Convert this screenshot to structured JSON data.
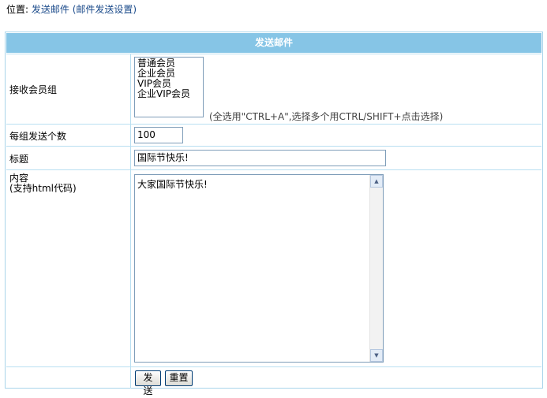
{
  "breadcrumb": {
    "prefix": "位置:",
    "link1": "发送邮件",
    "link2": "(邮件发送设置)"
  },
  "form": {
    "title": "发送邮件",
    "group_label": "接收会员组",
    "groups": [
      "普通会员",
      "企业会员",
      "VIP会员",
      "企业VIP会员"
    ],
    "group_hint": "(全选用\"CTRL+A\",选择多个用CTRL/SHIFT+点击选择)",
    "count_label": "每组发送个数",
    "count_value": "100",
    "subject_label": "标题",
    "subject_value": "国际节快乐!",
    "content_label": "内容",
    "content_sublabel": "(支持html代码)",
    "content_value": "大家国际节快乐!",
    "send_button": "发送",
    "reset_button": "重置"
  },
  "colors": {
    "header_bg": "#86c5e6",
    "border": "#b9dff1",
    "link": "#1a4a8a"
  },
  "icons": {
    "scroll_up": "up-arrow",
    "scroll_down": "down-arrow"
  }
}
